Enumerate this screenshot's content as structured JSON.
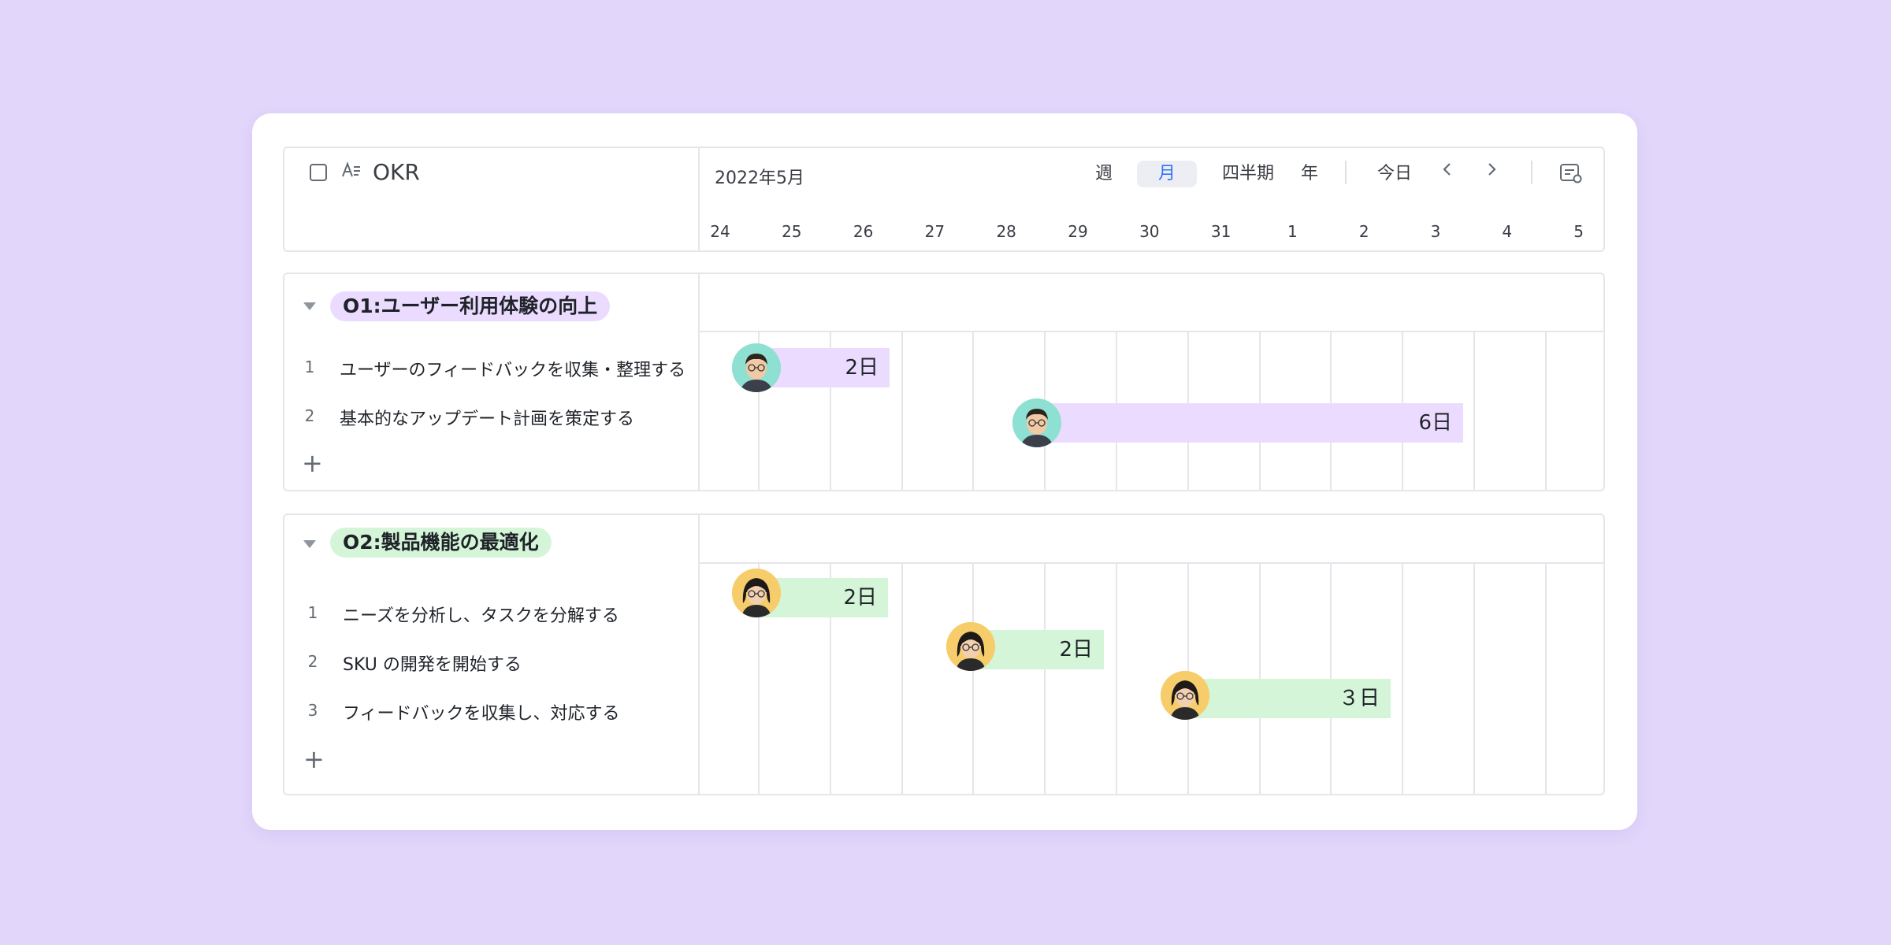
{
  "header": {
    "field_title": "OKR",
    "month_label": "2022年5月",
    "views": {
      "week": "週",
      "month": "月",
      "quarter": "四半期",
      "year": "年"
    },
    "active_view": "month",
    "today": "今日",
    "days": [
      "24",
      "25",
      "26",
      "27",
      "28",
      "29",
      "30",
      "31",
      "1",
      "2",
      "3",
      "4",
      "5"
    ]
  },
  "groups": [
    {
      "title": "O1:ユーザー利用体験の向上",
      "color": "#ebdcff",
      "tasks": [
        {
          "num": "1",
          "name": "ユーザーのフィードバックを収集・整理する",
          "duration": "2日"
        },
        {
          "num": "2",
          "name": "基本的なアップデート計画を策定する",
          "duration": "6日"
        }
      ]
    },
    {
      "title": "O2:製品機能の最適化",
      "color": "#d5f5d8",
      "tasks": [
        {
          "num": "1",
          "name": "ニーズを分析し、タスクを分解する",
          "duration": "2日"
        },
        {
          "num": "2",
          "name": "SKU の開発を開始する",
          "duration": "2日"
        },
        {
          "num": "3",
          "name": "フィードバックを収集し、対応する",
          "duration": "３日"
        }
      ]
    }
  ],
  "add_label": "+",
  "colors": {
    "background": "#e2d6fb",
    "accent": "#3370ff",
    "bar_purple": "#ebdcff",
    "bar_green": "#d5f5d8"
  }
}
